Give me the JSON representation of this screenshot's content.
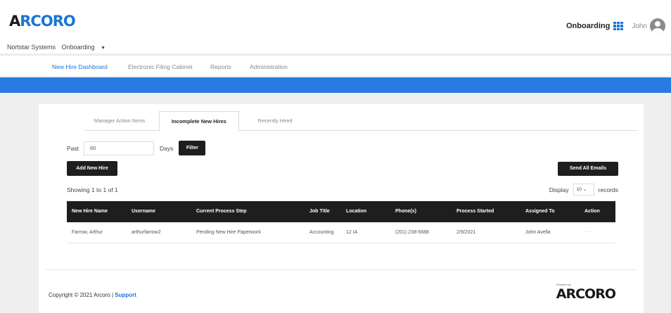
{
  "header": {
    "logo_a": "A",
    "logo_rest": "RCORO",
    "subnav": {
      "company": "Nortstar Systems",
      "module": "Onboarding"
    },
    "app_name": "Onboarding",
    "user_name": "John"
  },
  "nav": {
    "items": [
      {
        "label": "New Hire Dashboard",
        "active": true
      },
      {
        "label": "Electronic Filing Cabinet",
        "active": false
      },
      {
        "label": "Reports",
        "active": false
      },
      {
        "label": "Administration",
        "active": false
      }
    ]
  },
  "tabs": [
    {
      "label": "Manager Action Items",
      "active": false
    },
    {
      "label": "Incomplete New Hires",
      "active": true
    },
    {
      "label": "Recently Hired",
      "active": false
    }
  ],
  "filter": {
    "past_label": "Past",
    "past_value": "60",
    "days_label": "Days",
    "filter_button": "Filter"
  },
  "actions": {
    "add_new_hire": "Add New Hire",
    "send_all_emails": "Send All Emails"
  },
  "list": {
    "showing": "Showing 1 to 1 of 1",
    "display_label": "Display",
    "display_value": "10",
    "records_label": "records"
  },
  "table": {
    "columns": [
      "New Hire Name",
      "Username",
      "Current Process Step",
      "Job Title",
      "Location",
      "Phone(s)",
      "Process Started",
      "Assigned To",
      "Action"
    ],
    "rows": [
      [
        "Farrow, Arthur",
        "arthurfarrow2",
        "Pending New Hire Paperwork",
        "Accounting",
        "12 IA",
        "(201) 238-5688",
        "2/9/2021",
        "John Avella",
        "..."
      ]
    ]
  },
  "footer": {
    "copyright": "Copyright © 2021 Arcoro | ",
    "support": "Support",
    "powered_by": "Powered by",
    "powered_logo": "ARCORO"
  },
  "colors": {
    "brand_blue": "#1976d2",
    "bar_blue": "#2a7ae2",
    "dark_button": "#1e1e1e"
  }
}
